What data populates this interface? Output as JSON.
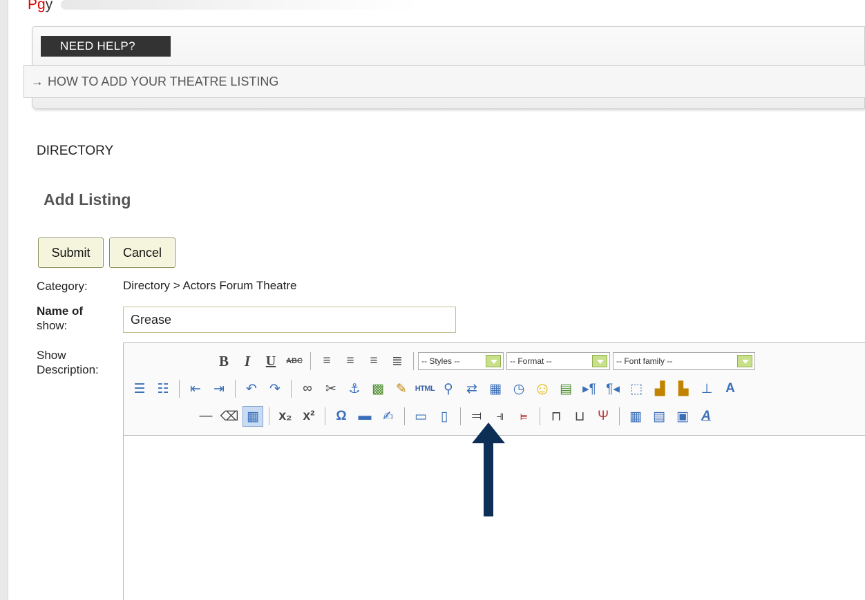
{
  "caption": {
    "red_text": "Pg",
    "rest_text": "y"
  },
  "help": {
    "tab_label": "NEED HELP?",
    "link_arrow": "→",
    "link_label": "HOW TO ADD YOUR THEATRE LISTING"
  },
  "directory_label": "DIRECTORY",
  "page_title": "Add Listing",
  "buttons": {
    "submit": "Submit",
    "cancel": "Cancel"
  },
  "form": {
    "category_label": "Category:",
    "category_value": "Directory > Actors Forum Theatre",
    "name_label_line1": "Name of",
    "name_label_line2": "show:",
    "name_value": "Grease",
    "description_label_line1": "Show",
    "description_label_line2": "Description:"
  },
  "toolbar": {
    "styles": "-- Styles --",
    "format": "-- Format --",
    "font_family": "-- Font family --",
    "html_label": "HTML"
  },
  "colors": {
    "annotation_arrow": "#0d2f57",
    "caption_red": "#e00000",
    "help_tab": "#333333"
  }
}
